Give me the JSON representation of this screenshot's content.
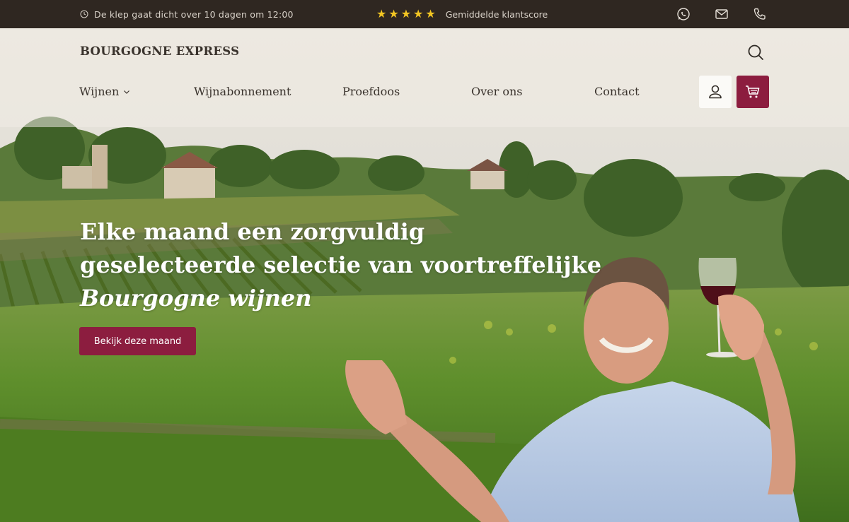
{
  "topbar": {
    "countdown": "De klep gaat dicht over 10 dagen om 12:00",
    "rating_stars": 5,
    "rating_label": "Gemiddelde klantscore",
    "icons": [
      "whatsapp-icon",
      "mail-icon",
      "phone-icon"
    ]
  },
  "header": {
    "brand": "BOURGOGNE EXPRESS",
    "nav": [
      "Wijnen",
      "Wijnabonnement",
      "Proefdoos",
      "Over ons",
      "Contact"
    ],
    "icons": [
      "search-icon",
      "user-icon",
      "cart-icon"
    ]
  },
  "hero": {
    "headline_line1": "Elke maand een zorgvuldig",
    "headline_line2": "geselecteerde selectie van voortreffelijke",
    "headline_italic": "Bourgogne wijnen",
    "cta": "Bekijk deze maand"
  },
  "colors": {
    "topbar_bg": "#2f2721",
    "accent": "#8c1d3f",
    "star": "#f3c623",
    "text_dark": "#3a332d"
  }
}
